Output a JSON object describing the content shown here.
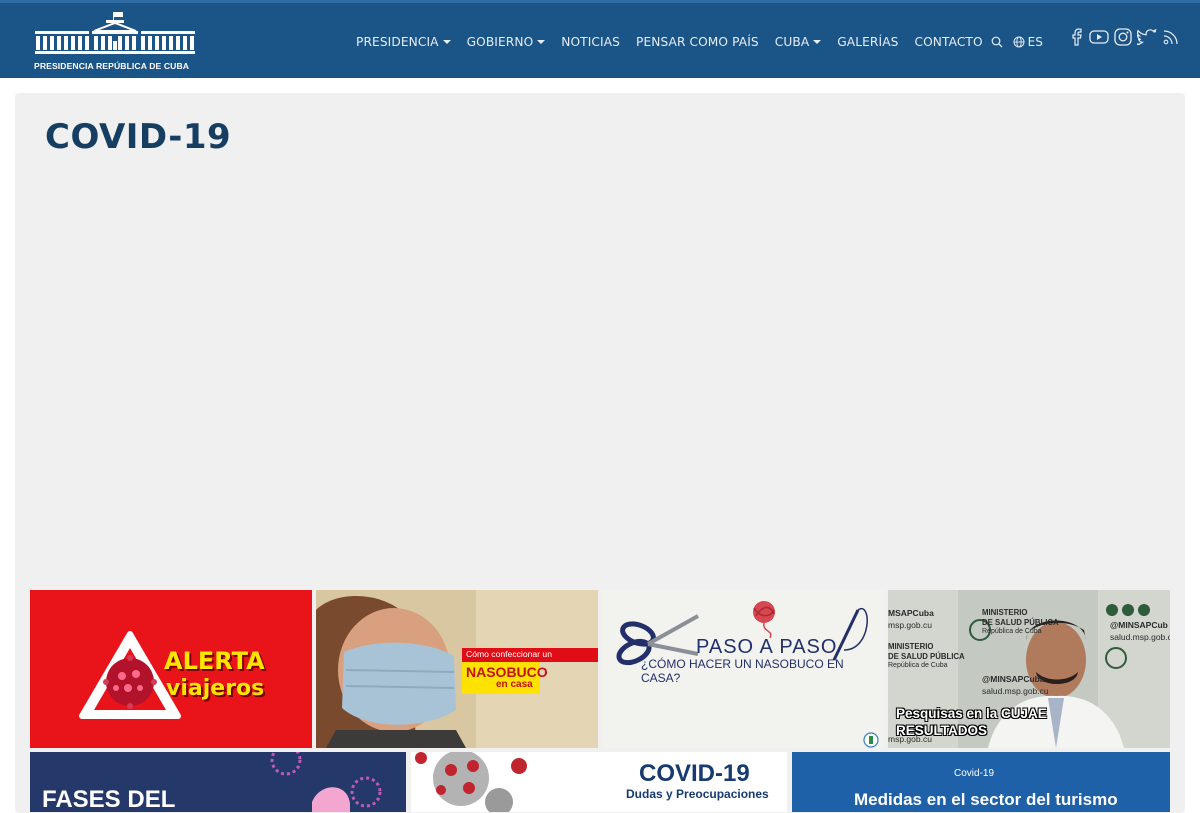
{
  "brand": {
    "logo_text": "PRESIDENCIA REPÚBLICA DE CUBA"
  },
  "nav": {
    "items": [
      {
        "label": "PRESIDENCIA",
        "dropdown": true
      },
      {
        "label": "GOBIERNO",
        "dropdown": true
      },
      {
        "label": "NOTICIAS",
        "dropdown": false
      },
      {
        "label": "PENSAR COMO PAÍS",
        "dropdown": false
      },
      {
        "label": "CUBA",
        "dropdown": true
      },
      {
        "label": "GALERÍAS",
        "dropdown": false
      },
      {
        "label": "CONTACTO",
        "dropdown": false
      }
    ],
    "language": "ES",
    "icons": [
      "search-icon",
      "globe-icon",
      "facebook-icon",
      "youtube-icon",
      "instagram-icon",
      "twitter-icon",
      "rss-icon"
    ]
  },
  "page": {
    "title": "COVID-19"
  },
  "thumbnails": {
    "t1": {
      "line1": "ALERTA",
      "line2": "viajeros"
    },
    "t2": {
      "line1": "Cómo confeccionar un",
      "line2": "NASOBUCO",
      "line3": "en casa"
    },
    "t3": {
      "line1": "PASO A PASO",
      "line2": "¿CÓMO HACER UN NASOBUCO EN CASA?"
    },
    "t4": {
      "line1": "Pesquisas en la CUJAE",
      "line2": "RESULTADOS",
      "handle1": "@MINSAPCuba",
      "handle2": "salud.msp.gob.cu",
      "org1": "MINISTERIO",
      "org2": "DE SALUD PÚBLICA",
      "org3": "República de Cuba",
      "handle3": "MSAPCuba",
      "handle4": "msp.gob.cu",
      "handle5": "@MINSAPCub",
      "handle6": "salud.msp.gob.cu",
      "org4": "MINISTERIO",
      "org5": "DE SALUD PÚBLICA",
      "org6": "República de Cuba"
    },
    "t5": {
      "line1": "FASES DEL"
    },
    "t6": {
      "line1": "COVID-19",
      "line2": "Dudas y Preocupaciones"
    },
    "t7": {
      "line1": "Covid-19",
      "line2": "Medidas en el sector del turismo"
    }
  },
  "colors": {
    "header_bg": "#1b5486",
    "title": "#163e63",
    "panel_bg": "#f0f0f0"
  }
}
